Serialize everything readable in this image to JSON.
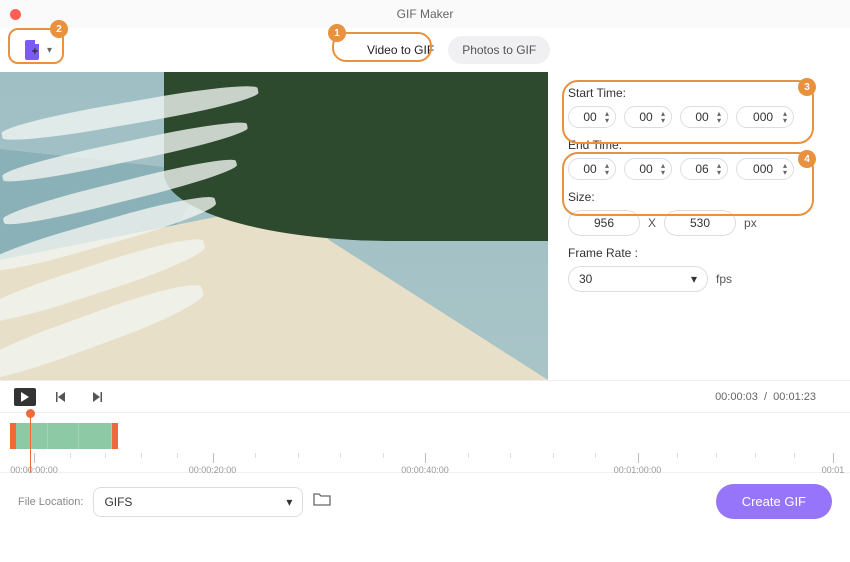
{
  "window": {
    "title": "GIF Maker"
  },
  "tabs": {
    "video": "Video to GIF",
    "photos": "Photos to GIF"
  },
  "settings": {
    "start_label": "Start Time:",
    "start": {
      "h": "00",
      "m": "00",
      "s": "00",
      "ms": "000"
    },
    "end_label": "End Time:",
    "end": {
      "h": "00",
      "m": "00",
      "s": "06",
      "ms": "000"
    },
    "size_label": "Size:",
    "size": {
      "w": "956",
      "h": "530",
      "unit": "px"
    },
    "frame_label": "Frame Rate :",
    "frame_rate": "30",
    "frame_unit": "fps"
  },
  "player": {
    "current": "00:00:03",
    "total": "00:01:23"
  },
  "timeline": {
    "marks": [
      "00:00:00:00",
      "00:00:20:00",
      "00:00:40:00",
      "00:01:00:00",
      "00:01"
    ]
  },
  "footer": {
    "label": "File Location:",
    "location": "GIFS",
    "create": "Create GIF"
  },
  "annotations": {
    "a1": "1",
    "a2": "2",
    "a3": "3",
    "a4": "4"
  }
}
